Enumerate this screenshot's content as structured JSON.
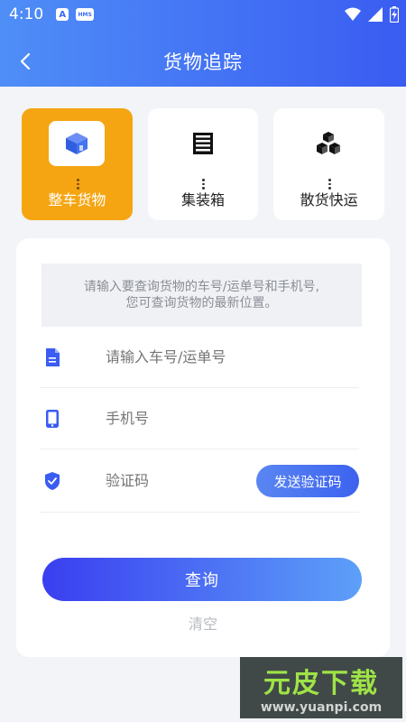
{
  "status_bar": {
    "time": "4:10",
    "badge_a": "A",
    "badge_hms": "HMS",
    "icons": [
      "wifi-icon",
      "signal-icon",
      "battery-charging-icon"
    ]
  },
  "header": {
    "title": "货物追踪",
    "back_icon": "chevron-left-icon",
    "gradient_colors": [
      "#4f8ef7",
      "#3a5cf2"
    ]
  },
  "categories": [
    {
      "label": "整车货物",
      "icon": "truck-box-icon",
      "active": true
    },
    {
      "label": "集装箱",
      "icon": "container-icon",
      "active": false
    },
    {
      "label": "散货快运",
      "icon": "boxes-icon",
      "active": false
    }
  ],
  "accent_color": "#f5a512",
  "form": {
    "notice_line1": "请输入要查询货物的车号/运单号和手机号,",
    "notice_line2": "您可查询货物的最新位置。",
    "waybill_placeholder": "请输入车号/运单号",
    "phone_placeholder": "手机号",
    "code_placeholder": "验证码",
    "send_code_label": "发送验证码",
    "query_label": "查询",
    "clear_label": "清空"
  },
  "watermark": {
    "main": "元皮下载",
    "sub": "www.yuanpi.com"
  }
}
